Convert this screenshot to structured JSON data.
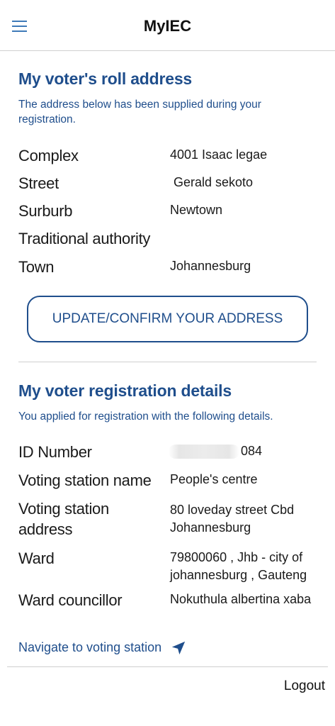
{
  "header": {
    "title": "MyIEC"
  },
  "roll_address": {
    "title": "My voter's roll address",
    "description": "The address below has been supplied during your registration.",
    "fields": [
      {
        "label": "Complex",
        "value": "4001 Isaac legae"
      },
      {
        "label": "Street",
        "value": " Gerald sekoto"
      },
      {
        "label": "Surburb",
        "value": "Newtown"
      },
      {
        "label": "Traditional authority",
        "value": ""
      },
      {
        "label": "Town",
        "value": "Johannesburg"
      }
    ],
    "update_button_label": "UPDATE/CONFIRM YOUR ADDRESS"
  },
  "registration": {
    "title": "My voter registration details",
    "description": "You applied for registration with the following details.",
    "fields": [
      {
        "label": "ID Number",
        "value": "084"
      },
      {
        "label": "Voting station name",
        "value": "People's centre"
      },
      {
        "label": "Voting station address",
        "value": "80 loveday street Cbd Johannesburg"
      },
      {
        "label": "Ward",
        "value": "79800060 , Jhb - city of johannesburg , Gauteng"
      },
      {
        "label": "Ward councillor",
        "value": "Nokuthula albertina xaba"
      }
    ]
  },
  "navigate_link_label": "Navigate to voting station",
  "logout_label": "Logout",
  "colors": {
    "accent": "#1f4e8c",
    "menu_icon": "#3f7ab8"
  },
  "icons": {
    "menu": "hamburger-menu-icon",
    "navigate": "navigation-arrow-icon"
  }
}
